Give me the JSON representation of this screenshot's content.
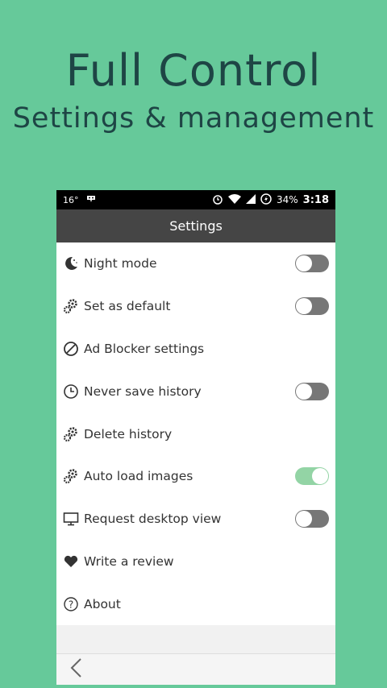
{
  "hero": {
    "title": "Full Control",
    "subtitle": "Settings & management"
  },
  "status": {
    "temp": "16°",
    "battery": "34%",
    "time": "3:18"
  },
  "appbar": {
    "title": "Settings"
  },
  "settings": [
    {
      "label": "Night mode",
      "icon": "moon-icon",
      "toggle": true,
      "on": false
    },
    {
      "label": "Set as default",
      "icon": "gears-icon",
      "toggle": true,
      "on": false
    },
    {
      "label": "Ad Blocker settings",
      "icon": "block-icon",
      "toggle": false
    },
    {
      "label": "Never save history",
      "icon": "clock-icon",
      "toggle": true,
      "on": false
    },
    {
      "label": "Delete history",
      "icon": "gears-icon",
      "toggle": false
    },
    {
      "label": "Auto load images",
      "icon": "gears-icon",
      "toggle": true,
      "on": true
    },
    {
      "label": "Request desktop view",
      "icon": "monitor-icon",
      "toggle": true,
      "on": false
    },
    {
      "label": "Write a review",
      "icon": "heart-icon",
      "toggle": false
    },
    {
      "label": "About",
      "icon": "help-icon",
      "toggle": false
    }
  ]
}
